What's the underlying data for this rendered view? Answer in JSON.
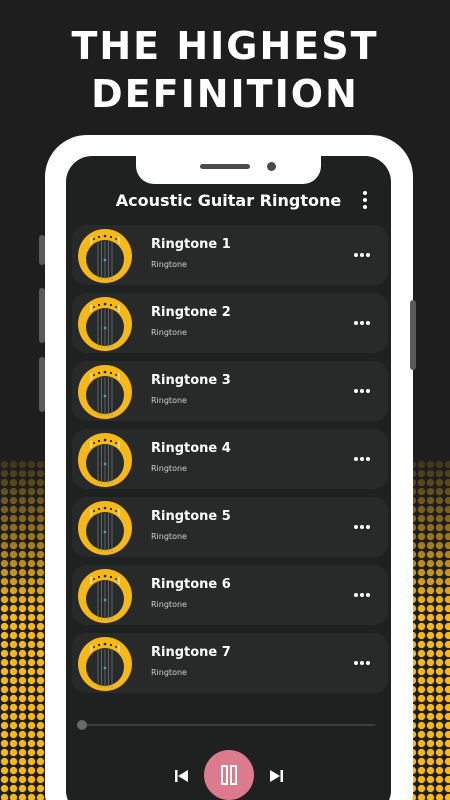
{
  "promo": {
    "headline_line1": "THE HIGHEST",
    "headline_line2": "DEFINITION"
  },
  "app": {
    "title": "Acoustic Guitar Ringtone",
    "menu_icon": "more-vert-icon"
  },
  "ringtones": [
    {
      "title": "Ringtone 1",
      "subtitle": "Ringtone"
    },
    {
      "title": "Ringtone 2",
      "subtitle": "Ringtone"
    },
    {
      "title": "Ringtone 3",
      "subtitle": "Ringtone"
    },
    {
      "title": "Ringtone 4",
      "subtitle": "Ringtone"
    },
    {
      "title": "Ringtone 5",
      "subtitle": "Ringtone"
    },
    {
      "title": "Ringtone 6",
      "subtitle": "Ringtone"
    },
    {
      "title": "Ringtone 7",
      "subtitle": "Ringtone"
    }
  ],
  "player": {
    "progress": 0.0,
    "state": "playing",
    "prev_icon": "skip-previous-icon",
    "pause_icon": "pause-icon",
    "next_icon": "skip-next-icon"
  },
  "colors": {
    "background": "#1e1e1e",
    "accent_yellow": "#f5b818",
    "screen_bg": "#1f2121",
    "item_bg": "#272a29",
    "pause_button": "#dd7b8e"
  }
}
